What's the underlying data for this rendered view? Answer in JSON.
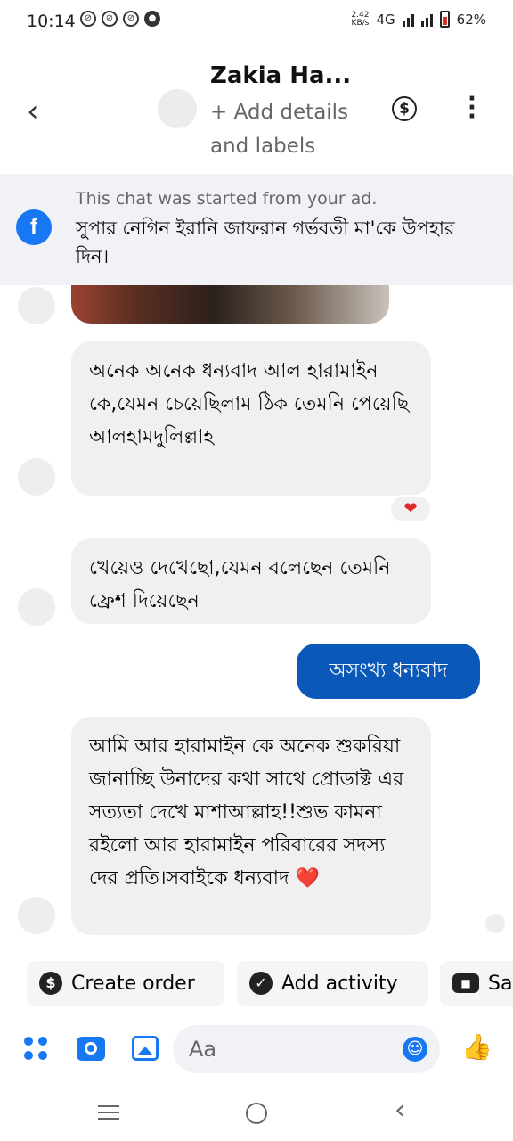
{
  "status_bar": {
    "time": "10:14",
    "net_speed_value": "2.42",
    "net_speed_unit": "KB/s",
    "network_type": "4G",
    "battery": "62%"
  },
  "header": {
    "contact_name": "Zakia Ha...",
    "add_details": "+ Add details and labels"
  },
  "ad_banner": {
    "started_text": "This chat was started from your ad.",
    "ad_text": "সুপার নেগিন ইরানি জাফরান গর্ভবতী মা'কে উপহার দিন।"
  },
  "messages": [
    {
      "direction": "in",
      "text": "অনেক অনেক ধন্যবাদ আল হারামাইন কে,যেমন চেয়েছিলাম ঠিক তেমনি পেয়েছি আলহামদুলিল্লাহ",
      "reaction": "❤"
    },
    {
      "direction": "in",
      "text": "খেয়েও দেখেছো,যেমন বলেছেন তেমনি ফ্রেশ দিয়েছেন"
    },
    {
      "direction": "out",
      "text": "অসংখ্য ধন্যবাদ"
    },
    {
      "direction": "in",
      "text": "আমি আর হারামাইন কে অনেক শুকরিয়া জানাচ্ছি উনাদের কথা সাথে প্রোডাক্ট এর সত্যতা দেখে মাশাআল্লাহ!!শুভ কামনা রইলো আর হারামাইন পরিবারের সদস্য দের প্রতি।সবাইকে ধন্যবাদ ❤️"
    }
  ],
  "actions": {
    "create_order": "Create order",
    "add_activity": "Add activity",
    "saved_replies": "Sa"
  },
  "composer": {
    "placeholder": "Aa"
  },
  "icons": {
    "accent": "#1877f2",
    "outgoing_bubble": "#0a59b8"
  }
}
